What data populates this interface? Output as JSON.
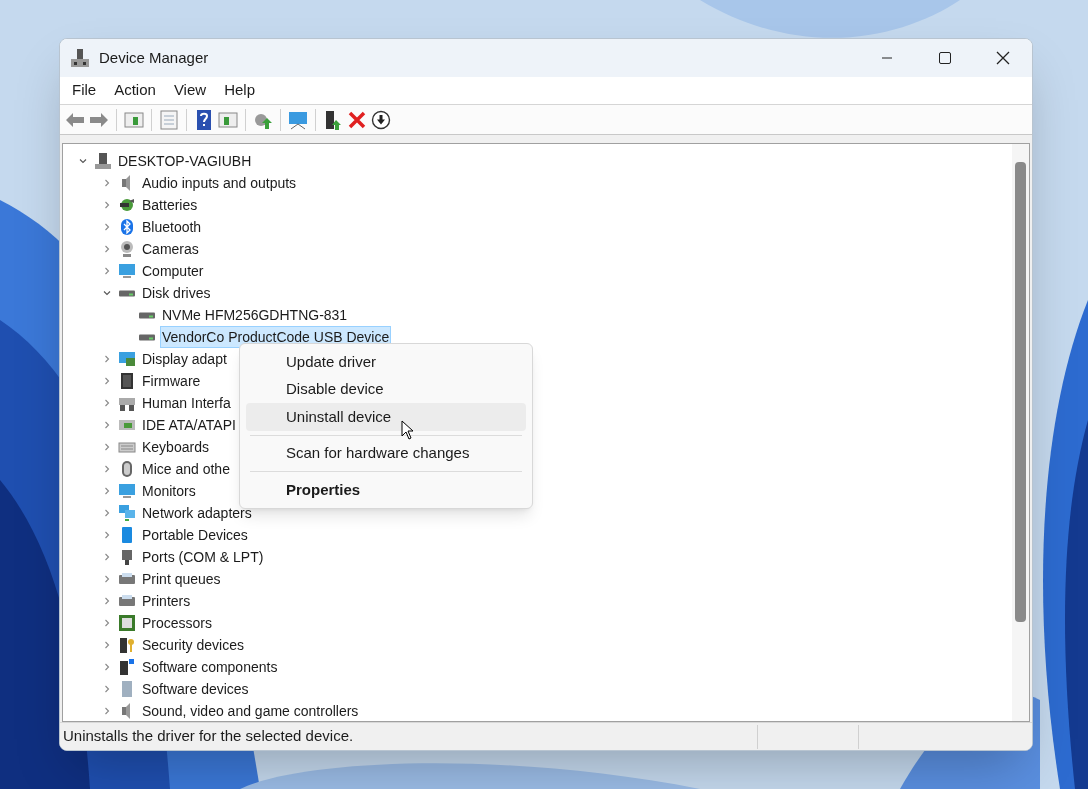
{
  "window": {
    "title": "Device Manager"
  },
  "menu_bar": [
    "File",
    "Action",
    "View",
    "Help"
  ],
  "tree": {
    "label": "DESKTOP-VAGIUBH",
    "expanded": true,
    "selected": false,
    "children": [
      {
        "label": "Audio inputs and outputs",
        "expanded": false,
        "selected": false
      },
      {
        "label": "Batteries",
        "expanded": false,
        "selected": false
      },
      {
        "label": "Bluetooth",
        "expanded": false,
        "selected": false
      },
      {
        "label": "Cameras",
        "expanded": false,
        "selected": false
      },
      {
        "label": "Computer",
        "expanded": false,
        "selected": false
      },
      {
        "label": "Disk drives",
        "expanded": true,
        "selected": false,
        "children": [
          {
            "label": "NVMe HFM256GDHTNG-831",
            "selected": false
          },
          {
            "label": "VendorCo ProductCode USB Device",
            "selected": true
          }
        ]
      },
      {
        "label": "Display adapt",
        "expanded": false,
        "selected": false
      },
      {
        "label": "Firmware",
        "expanded": false,
        "selected": false
      },
      {
        "label": "Human Interfa",
        "expanded": false,
        "selected": false
      },
      {
        "label": "IDE ATA/ATAPI",
        "expanded": false,
        "selected": false
      },
      {
        "label": "Keyboards",
        "expanded": false,
        "selected": false
      },
      {
        "label": "Mice and othe",
        "expanded": false,
        "selected": false
      },
      {
        "label": "Monitors",
        "expanded": false,
        "selected": false
      },
      {
        "label": "Network adapters",
        "expanded": false,
        "selected": false
      },
      {
        "label": "Portable Devices",
        "expanded": false,
        "selected": false
      },
      {
        "label": "Ports (COM & LPT)",
        "expanded": false,
        "selected": false
      },
      {
        "label": "Print queues",
        "expanded": false,
        "selected": false
      },
      {
        "label": "Printers",
        "expanded": false,
        "selected": false
      },
      {
        "label": "Processors",
        "expanded": false,
        "selected": false
      },
      {
        "label": "Security devices",
        "expanded": false,
        "selected": false
      },
      {
        "label": "Software components",
        "expanded": false,
        "selected": false
      },
      {
        "label": "Software devices",
        "expanded": false,
        "selected": false
      },
      {
        "label": "Sound, video and game controllers",
        "expanded": false,
        "selected": false
      }
    ]
  },
  "context_menu": [
    {
      "kind": "item",
      "label": "Update driver",
      "selected": false,
      "bold": false
    },
    {
      "kind": "item",
      "label": "Disable device",
      "selected": false,
      "bold": false
    },
    {
      "kind": "item",
      "label": "Uninstall device",
      "selected": true,
      "bold": false
    },
    {
      "kind": "separator"
    },
    {
      "kind": "item",
      "label": "Scan for hardware changes",
      "selected": false,
      "bold": false
    },
    {
      "kind": "separator"
    },
    {
      "kind": "item",
      "label": "Properties",
      "selected": false,
      "bold": true
    }
  ],
  "status_bar": {
    "text": "Uninstalls the driver for the selected device."
  }
}
